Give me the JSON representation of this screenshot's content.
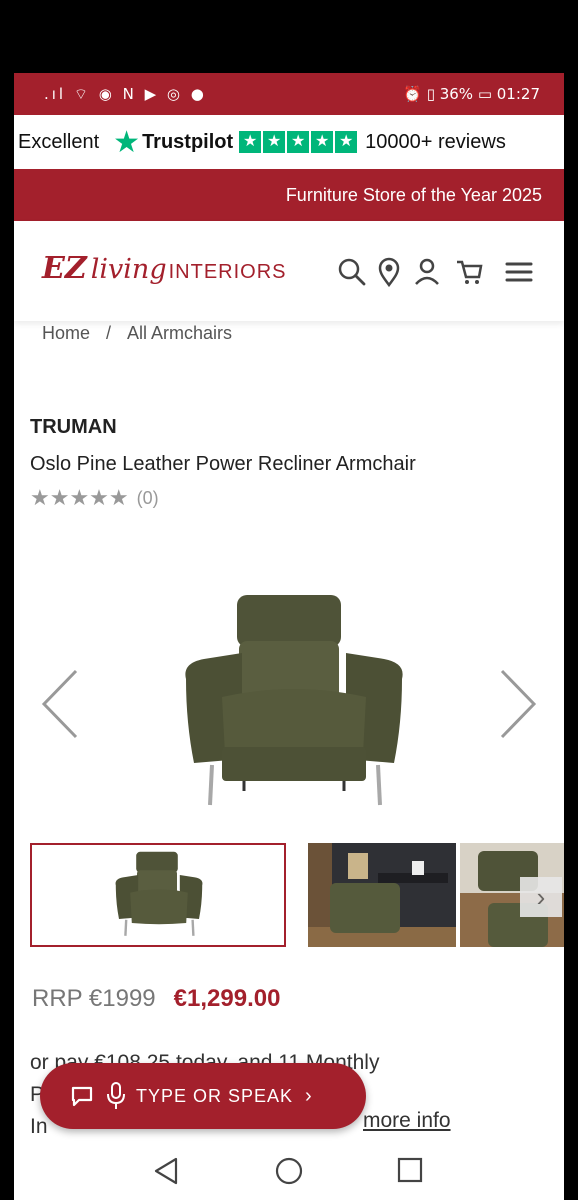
{
  "status_bar": {
    "left_icons": ".ıl ⌔ ◉ N ▶ ◎ ●",
    "right_text": "⏰ ▯ 36% ▭ 01:27"
  },
  "trustpilot": {
    "rating_word": "Excellent",
    "brand": "Trustpilot",
    "reviews": "10000+ reviews",
    "color": "#00b67a"
  },
  "promo": {
    "text": "Furniture Store of the Year 2025"
  },
  "header": {
    "logo_ez": "EZ",
    "logo_living": "living",
    "logo_interiors": "INTERIORS"
  },
  "icons": {
    "search": "search-icon",
    "location": "location-pin-icon",
    "account": "user-icon",
    "cart": "cart-icon",
    "menu": "hamburger-menu-icon"
  },
  "breadcrumb": {
    "home": "Home",
    "separator": "/",
    "current": "All Armchairs"
  },
  "product": {
    "brand": "TRUMAN",
    "title": "Oslo Pine Leather Power Recliner Armchair",
    "stars": "★★★★★",
    "review_count": "(0)"
  },
  "price": {
    "rrp": "RRP €1999",
    "sale": "€1,299.00"
  },
  "finance": {
    "line1": "or pay €108.25 today, and 11 Monthly",
    "line2_start": "P",
    "line3_start": "In",
    "more_info": "more info"
  },
  "assistant": {
    "label": "TYPE OR SPEAK",
    "chevron": "›"
  },
  "colors": {
    "brand_red": "#a3202c",
    "trustpilot_green": "#00b67a"
  }
}
